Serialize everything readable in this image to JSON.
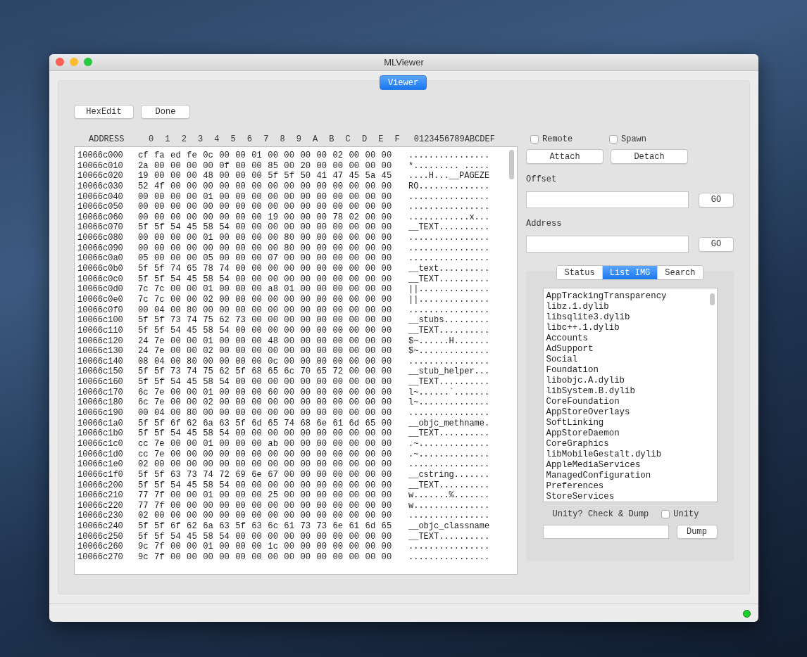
{
  "window": {
    "title": "MLViewer"
  },
  "mode_tab": {
    "label": "Viewer",
    "selected": true
  },
  "toolbar": {
    "buttons": [
      "HexEdit",
      "Done"
    ]
  },
  "hex_header": {
    "address": "ADDRESS",
    "columns": [
      "0",
      "1",
      "2",
      "3",
      "4",
      "5",
      "6",
      "7",
      "8",
      "9",
      "A",
      "B",
      "C",
      "D",
      "E",
      "F"
    ],
    "ascii": "0123456789ABCDEF"
  },
  "hex_rows": [
    {
      "address": "10066c000",
      "hex": "cf fa ed fe 0c 00 00 01 00 00 00 00 02 00 00 00",
      "ascii": "................"
    },
    {
      "address": "10066c010",
      "hex": "2a 00 00 00 00 0f 00 00 85 00 20 00 00 00 00 00",
      "ascii": "*......... ....."
    },
    {
      "address": "10066c020",
      "hex": "19 00 00 00 48 00 00 00 5f 5f 50 41 47 45 5a 45",
      "ascii": "....H...__PAGEZE"
    },
    {
      "address": "10066c030",
      "hex": "52 4f 00 00 00 00 00 00 00 00 00 00 00 00 00 00",
      "ascii": "RO.............."
    },
    {
      "address": "10066c040",
      "hex": "00 00 00 00 01 00 00 00 00 00 00 00 00 00 00 00",
      "ascii": "................"
    },
    {
      "address": "10066c050",
      "hex": "00 00 00 00 00 00 00 00 00 00 00 00 00 00 00 00",
      "ascii": "................"
    },
    {
      "address": "10066c060",
      "hex": "00 00 00 00 00 00 00 00 19 00 00 00 78 02 00 00",
      "ascii": "............x..."
    },
    {
      "address": "10066c070",
      "hex": "5f 5f 54 45 58 54 00 00 00 00 00 00 00 00 00 00",
      "ascii": "__TEXT.........."
    },
    {
      "address": "10066c080",
      "hex": "00 00 00 00 01 00 00 00 00 80 00 00 00 00 00 00",
      "ascii": "................"
    },
    {
      "address": "10066c090",
      "hex": "00 00 00 00 00 00 00 00 00 80 00 00 00 00 00 00",
      "ascii": "................"
    },
    {
      "address": "10066c0a0",
      "hex": "05 00 00 00 05 00 00 00 07 00 00 00 00 00 00 00",
      "ascii": "................"
    },
    {
      "address": "10066c0b0",
      "hex": "5f 5f 74 65 78 74 00 00 00 00 00 00 00 00 00 00",
      "ascii": "__text.........."
    },
    {
      "address": "10066c0c0",
      "hex": "5f 5f 54 45 58 54 00 00 00 00 00 00 00 00 00 00",
      "ascii": "__TEXT.........."
    },
    {
      "address": "10066c0d0",
      "hex": "7c 7c 00 00 01 00 00 00 a8 01 00 00 00 00 00 00",
      "ascii": "||.............."
    },
    {
      "address": "10066c0e0",
      "hex": "7c 7c 00 00 02 00 00 00 00 00 00 00 00 00 00 00",
      "ascii": "||.............."
    },
    {
      "address": "10066c0f0",
      "hex": "00 04 00 80 00 00 00 00 00 00 00 00 00 00 00 00",
      "ascii": "................"
    },
    {
      "address": "10066c100",
      "hex": "5f 5f 73 74 75 62 73 00 00 00 00 00 00 00 00 00",
      "ascii": "__stubs........."
    },
    {
      "address": "10066c110",
      "hex": "5f 5f 54 45 58 54 00 00 00 00 00 00 00 00 00 00",
      "ascii": "__TEXT.........."
    },
    {
      "address": "10066c120",
      "hex": "24 7e 00 00 01 00 00 00 48 00 00 00 00 00 00 00",
      "ascii": "$~......H......."
    },
    {
      "address": "10066c130",
      "hex": "24 7e 00 00 02 00 00 00 00 00 00 00 00 00 00 00",
      "ascii": "$~.............."
    },
    {
      "address": "10066c140",
      "hex": "08 04 00 80 00 00 00 00 0c 00 00 00 00 00 00 00",
      "ascii": "................"
    },
    {
      "address": "10066c150",
      "hex": "5f 5f 73 74 75 62 5f 68 65 6c 70 65 72 00 00 00",
      "ascii": "__stub_helper..."
    },
    {
      "address": "10066c160",
      "hex": "5f 5f 54 45 58 54 00 00 00 00 00 00 00 00 00 00",
      "ascii": "__TEXT.........."
    },
    {
      "address": "10066c170",
      "hex": "6c 7e 00 00 01 00 00 00 60 00 00 00 00 00 00 00",
      "ascii": "l~......`......."
    },
    {
      "address": "10066c180",
      "hex": "6c 7e 00 00 02 00 00 00 00 00 00 00 00 00 00 00",
      "ascii": "l~.............."
    },
    {
      "address": "10066c190",
      "hex": "00 04 00 80 00 00 00 00 00 00 00 00 00 00 00 00",
      "ascii": "................"
    },
    {
      "address": "10066c1a0",
      "hex": "5f 5f 6f 62 6a 63 5f 6d 65 74 68 6e 61 6d 65 00",
      "ascii": "__objc_methname."
    },
    {
      "address": "10066c1b0",
      "hex": "5f 5f 54 45 58 54 00 00 00 00 00 00 00 00 00 00",
      "ascii": "__TEXT.........."
    },
    {
      "address": "10066c1c0",
      "hex": "cc 7e 00 00 01 00 00 00 ab 00 00 00 00 00 00 00",
      "ascii": ".~.............."
    },
    {
      "address": "10066c1d0",
      "hex": "cc 7e 00 00 00 00 00 00 00 00 00 00 00 00 00 00",
      "ascii": ".~.............."
    },
    {
      "address": "10066c1e0",
      "hex": "02 00 00 00 00 00 00 00 00 00 00 00 00 00 00 00",
      "ascii": "................"
    },
    {
      "address": "10066c1f0",
      "hex": "5f 5f 63 73 74 72 69 6e 67 00 00 00 00 00 00 00",
      "ascii": "__cstring......."
    },
    {
      "address": "10066c200",
      "hex": "5f 5f 54 45 58 54 00 00 00 00 00 00 00 00 00 00",
      "ascii": "__TEXT.........."
    },
    {
      "address": "10066c210",
      "hex": "77 7f 00 00 01 00 00 00 25 00 00 00 00 00 00 00",
      "ascii": "w.......%......."
    },
    {
      "address": "10066c220",
      "hex": "77 7f 00 00 00 00 00 00 00 00 00 00 00 00 00 00",
      "ascii": "w..............."
    },
    {
      "address": "10066c230",
      "hex": "02 00 00 00 00 00 00 00 00 00 00 00 00 00 00 00",
      "ascii": "................"
    },
    {
      "address": "10066c240",
      "hex": "5f 5f 6f 62 6a 63 5f 63 6c 61 73 73 6e 61 6d 65",
      "ascii": "__objc_classname"
    },
    {
      "address": "10066c250",
      "hex": "5f 5f 54 45 58 54 00 00 00 00 00 00 00 00 00 00",
      "ascii": "__TEXT.........."
    },
    {
      "address": "10066c260",
      "hex": "9c 7f 00 00 01 00 00 00 1c 00 00 00 00 00 00 00",
      "ascii": "................"
    },
    {
      "address": "10066c270",
      "hex": "9c 7f 00 00 00 00 00 00 00 00 00 00 00 00 00 00",
      "ascii": "................"
    }
  ],
  "options": [
    {
      "label": "Remote",
      "checked": false
    },
    {
      "label": "Spawn",
      "checked": false
    }
  ],
  "attach_buttons": [
    "Attach",
    "Detach"
  ],
  "offset": {
    "label": "Offset",
    "button": "GO"
  },
  "address": {
    "label": "Address",
    "button": "GO"
  },
  "panel_tabs": [
    {
      "label": "Status",
      "selected": false
    },
    {
      "label": "List IMG",
      "selected": true
    },
    {
      "label": "Search",
      "selected": false
    }
  ],
  "images": [
    "AppTrackingTransparency",
    "libz.1.dylib",
    "libsqlite3.dylib",
    "libc++.1.dylib",
    "Accounts",
    "AdSupport",
    "Social",
    "Foundation",
    "libobjc.A.dylib",
    "libSystem.B.dylib",
    "CoreFoundation",
    "AppStoreOverlays",
    "SoftLinking",
    "AppStoreDaemon",
    "CoreGraphics",
    "libMobileGestalt.dylib",
    "AppleMediaServices",
    "ManagedConfiguration",
    "Preferences",
    "StoreServices"
  ],
  "unity": {
    "label": "Unity? Check & Dump",
    "checkbox": {
      "label": "Unity",
      "checked": false
    },
    "button": "Dump"
  },
  "status": {
    "connected": true
  }
}
